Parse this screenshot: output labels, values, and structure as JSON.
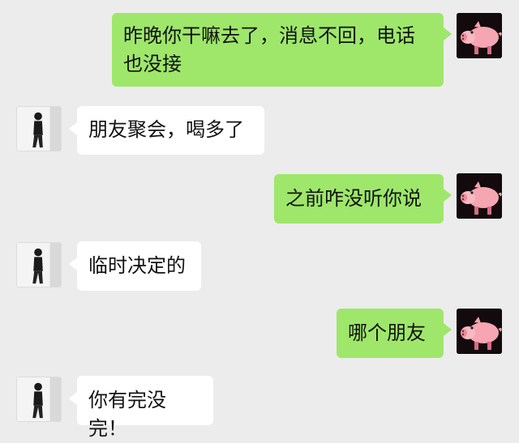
{
  "chat": {
    "messages": [
      {
        "side": "right",
        "text": "昨晚你干嘛去了，消息不回，电话也没接",
        "avatar": "pig-avatar"
      },
      {
        "side": "left",
        "text": "朋友聚会，喝多了",
        "avatar": "person-avatar"
      },
      {
        "side": "right",
        "text": "之前咋没听你说",
        "avatar": "pig-avatar"
      },
      {
        "side": "left",
        "text": "临时决定的",
        "avatar": "person-avatar"
      },
      {
        "side": "right",
        "text": "哪个朋友",
        "avatar": "pig-avatar"
      },
      {
        "side": "left",
        "text": "你有完没完！",
        "avatar": "person-avatar"
      }
    ]
  },
  "colors": {
    "background": "#ececec",
    "sent_bubble": "#9ee76a",
    "received_bubble": "#ffffff"
  }
}
